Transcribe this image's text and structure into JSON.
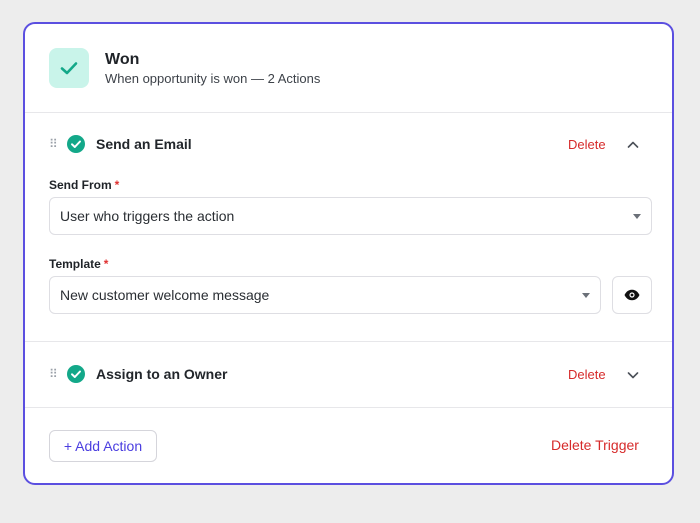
{
  "trigger": {
    "title": "Won",
    "subtitle": "When opportunity is won — 2 Actions",
    "icon": "check-icon",
    "icon_bg": "#c9f4ea",
    "icon_color": "#13a889"
  },
  "actions": [
    {
      "title": "Send an Email",
      "delete_label": "Delete",
      "expanded": true,
      "fields": {
        "send_from": {
          "label": "Send From",
          "required_mark": "*",
          "value": "User who triggers the action"
        },
        "template": {
          "label": "Template",
          "required_mark": "*",
          "value": "New customer welcome message"
        }
      }
    },
    {
      "title": "Assign to an Owner",
      "delete_label": "Delete",
      "expanded": false
    }
  ],
  "footer": {
    "add_action_label": "+ Add Action",
    "delete_trigger_label": "Delete Trigger"
  },
  "colors": {
    "accent": "#5b4fe0",
    "danger": "#d62a2a",
    "success": "#13a889"
  }
}
